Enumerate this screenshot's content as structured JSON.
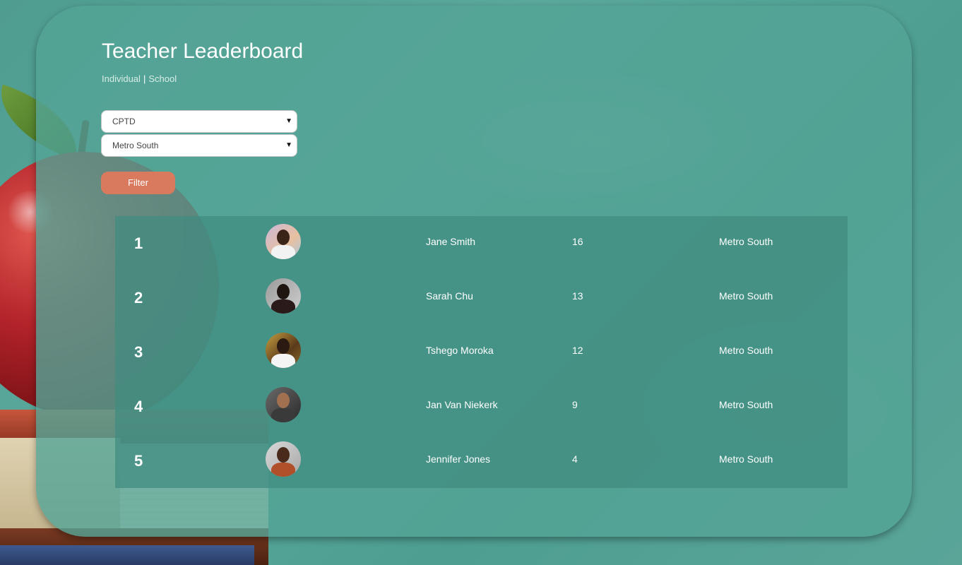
{
  "page": {
    "title": "Teacher Leaderboard",
    "tabs": [
      {
        "label": "Individual"
      },
      {
        "label": "School"
      }
    ],
    "tab_separator": "|"
  },
  "filters": {
    "category": {
      "selected": "CPTD"
    },
    "region": {
      "selected": "Metro South"
    },
    "filter_button_label": "Filter"
  },
  "leaderboard": [
    {
      "rank": "1",
      "name": "Jane Smith",
      "score": "16",
      "region": "Metro South"
    },
    {
      "rank": "2",
      "name": "Sarah Chu",
      "score": "13",
      "region": "Metro South"
    },
    {
      "rank": "3",
      "name": "Tshego Moroka",
      "score": "12",
      "region": "Metro South"
    },
    {
      "rank": "4",
      "name": "Jan Van Niekerk",
      "score": "9",
      "region": "Metro South"
    },
    {
      "rank": "5",
      "name": "Jennifer Jones",
      "score": "4",
      "region": "Metro South"
    }
  ],
  "icons": {
    "dropdown": "chevron-down-icon",
    "avatar": "avatar-photo"
  },
  "colors": {
    "background": "#54a496",
    "panel": "#54a496",
    "board": "#408c80",
    "filter_button": "#d97a5e",
    "text": "#ffffff"
  }
}
